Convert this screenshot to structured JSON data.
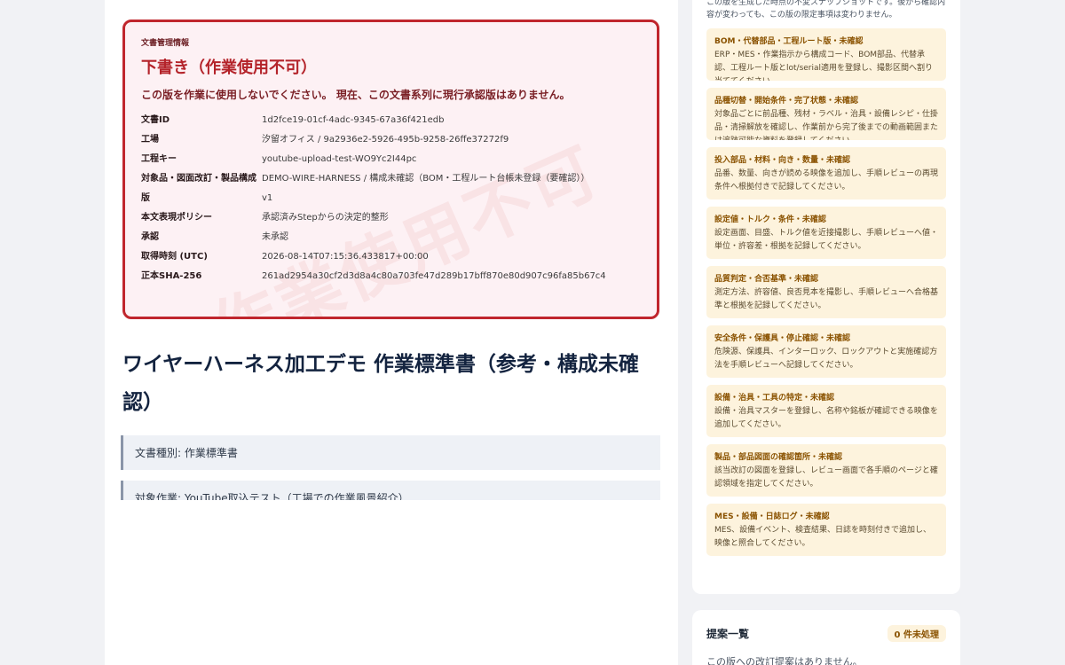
{
  "draft_notice": {
    "label": "文書管理情報",
    "title": "下書き（作業使用不可）",
    "warning": "この版を作業に使用しないでください。 現在、この文書系列に現行承認版はありません。",
    "watermark": "作業使用不可",
    "rows": [
      {
        "key": "文書ID",
        "value": "1d2fce19-01cf-4adc-9345-67a36f421edb"
      },
      {
        "key": "工場",
        "value": "汐留オフィス / 9a2936e2-5926-495b-9258-26ffe37272f9"
      },
      {
        "key": "工程キー",
        "value": "youtube-upload-test-WO9Yc2I44pc"
      },
      {
        "key": "対象品・図面改訂・製品構成",
        "value": "DEMO-WIRE-HARNESS / 構成未確認（BOM・工程ルート台帳未登録（要確認））"
      },
      {
        "key": "版",
        "value": "v1"
      },
      {
        "key": "本文表現ポリシー",
        "value": "承認済みStepからの決定的整形"
      },
      {
        "key": "承認",
        "value": "未承認"
      },
      {
        "key": "取得時刻 (UTC)",
        "value": "2026-08-14T07:15:36.433817+00:00"
      },
      {
        "key": "正本SHA-256",
        "value": "261ad2954a30cf2d3d8a4c80a703fe47d289b17bff870e80d907c96fa85b67c4"
      }
    ]
  },
  "document": {
    "heading": "ワイヤーハーネス加工デモ 作業標準書（参考・構成未確認）",
    "info_blocks": [
      "文書種別: 作業標準書",
      "対象作業: YouTube取込テスト（工場での作業風景紹介）"
    ]
  },
  "sidebar": {
    "intro": "この版を生成した時点の不変スナップショットです。後から確認内容が変わっても、この版の限定事項は変わりません。",
    "checklist": [
      {
        "title": "BOM・代替部品・工程ルート版・未確認",
        "desc": "ERP・MES・作業指示から構成コード、BOM部品、代替承認、工程ルート版とlot/serial適用を登録し、撮影区間へ割り当ててください。"
      },
      {
        "title": "品種切替・開始条件・完了状態・未確認",
        "desc": "対象品ごとに前品種、残材・ラベル・治具・設備レシピ・仕掛品・清掃解放を確認し、作業前から完了後までの動画範囲または追跡可能な資料を登録してください。"
      },
      {
        "title": "投入部品・材料・向き・数量・未確認",
        "desc": "品番、数量、向きが読める映像を追加し、手順レビューの再現条件へ根拠付きで記録してください。"
      },
      {
        "title": "設定値・トルク・条件・未確認",
        "desc": "設定画面、目盛、トルク値を近接撮影し、手順レビューへ値・単位・許容差・根拠を記録してください。"
      },
      {
        "title": "品質判定・合否基準・未確認",
        "desc": "測定方法、許容値、良否見本を撮影し、手順レビューへ合格基準と根拠を記録してください。"
      },
      {
        "title": "安全条件・保護具・停止確認・未確認",
        "desc": "危険源、保護具、インターロック、ロックアウトと実施確認方法を手順レビューへ記録してください。"
      },
      {
        "title": "設備・治具・工具の特定・未確認",
        "desc": "設備・治具マスターを登録し、名称や銘板が確認できる映像を追加してください。"
      },
      {
        "title": "製品・部品図面の確認箇所・未確認",
        "desc": "該当改訂の図面を登録し、レビュー画面で各手順のページと確認領域を指定してください。"
      },
      {
        "title": "MES・設備・日誌ログ・未確認",
        "desc": "MES、設備イベント、検査結果、日誌を時刻付きで追加し、映像と照合してください。"
      }
    ]
  },
  "proposals": {
    "title": "提案一覧",
    "badge": "0 件未処理",
    "empty_text": "この版への改訂提案はありません。"
  }
}
